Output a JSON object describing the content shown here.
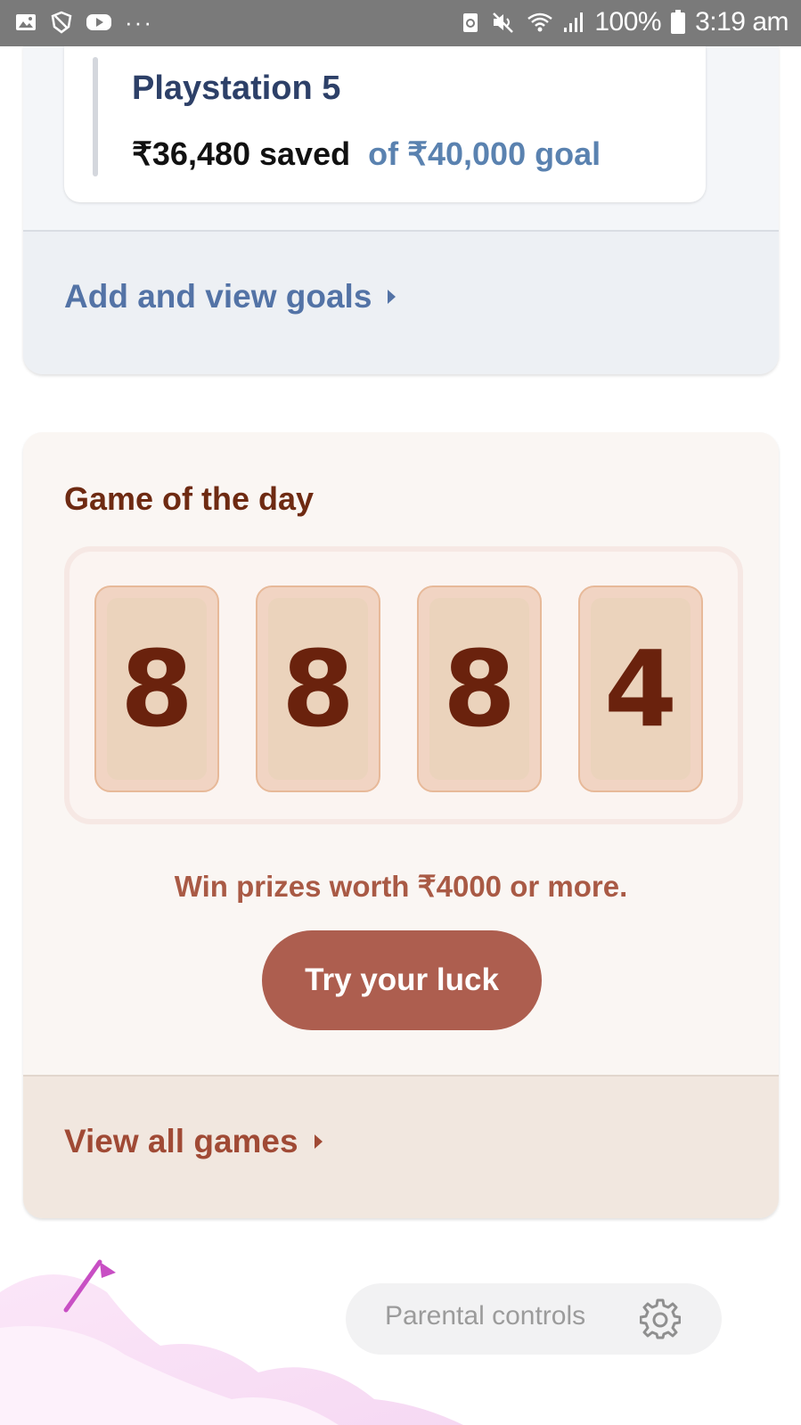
{
  "status_bar": {
    "left_icons": [
      "gallery-icon",
      "shield-icon",
      "youtube-icon",
      "more-dots-icon"
    ],
    "right_icons": [
      "battery-saver-icon",
      "mute-icon",
      "wifi-icon",
      "signal-icon",
      "battery-icon"
    ],
    "battery": "100%",
    "time": "3:19 am"
  },
  "goals": {
    "goal_name": "Playstation 5",
    "saved_text": "₹36,480 saved",
    "goal_text": "of ₹40,000 goal",
    "footer_link": "Add and view goals"
  },
  "game": {
    "title": "Game of the day",
    "digits": [
      "8",
      "8",
      "8",
      "4"
    ],
    "prize_text": "Win prizes worth ₹4000 or more.",
    "button_label": "Try your luck",
    "footer_link": "View all games"
  },
  "parental": {
    "label": "Parental controls",
    "icon": "gear-icon"
  },
  "colors": {
    "goal_blue": "#2d4068",
    "link_blue": "#5373a6",
    "game_brown": "#6e2a12",
    "button": "#ad5e4f",
    "tile": "#ebd3bc"
  }
}
